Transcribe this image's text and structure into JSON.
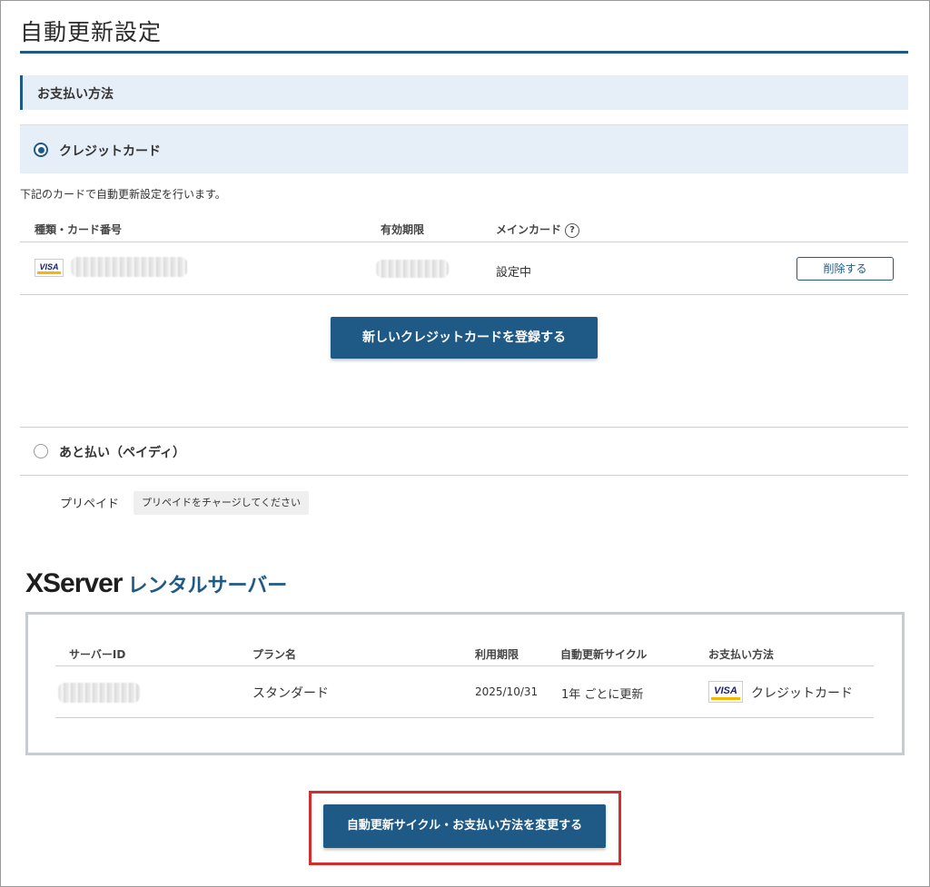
{
  "page_title": "自動更新設定",
  "payment_section": {
    "heading": "お支払い方法",
    "credit_card_option": "クレジットカード",
    "description": "下記のカードで自動更新設定を行います。",
    "table_headers": {
      "type_number": "種類・カード番号",
      "expiry": "有効期限",
      "main_card": "メインカード"
    },
    "card_row": {
      "brand": "VISA",
      "status": "設定中",
      "delete_label": "削除する"
    },
    "new_card_button": "新しいクレジットカードを登録する",
    "deferred_option": "あと払い（ペイディ）",
    "prepaid_label": "プリペイド",
    "prepaid_button": "プリペイドをチャージしてください"
  },
  "service": {
    "logo_main": "XServer",
    "logo_sub": "レンタルサーバー",
    "headers": [
      "サーバーID",
      "プラン名",
      "利用期限",
      "自動更新サイクル",
      "お支払い方法"
    ],
    "row": {
      "plan": "スタンダード",
      "expiry": "2025/10/31",
      "cycle": "1年 ごとに更新",
      "payment_brand": "VISA",
      "payment_method": "クレジットカード"
    }
  },
  "change_button": "自動更新サイクル・お支払い方法を変更する",
  "colors": {
    "brand_blue": "#1f5a86",
    "section_bg": "#e6eef8",
    "highlight_red": "#d22e2e"
  },
  "icons": {
    "help": "question-circle-icon",
    "card_brand": "visa-logo-icon"
  }
}
